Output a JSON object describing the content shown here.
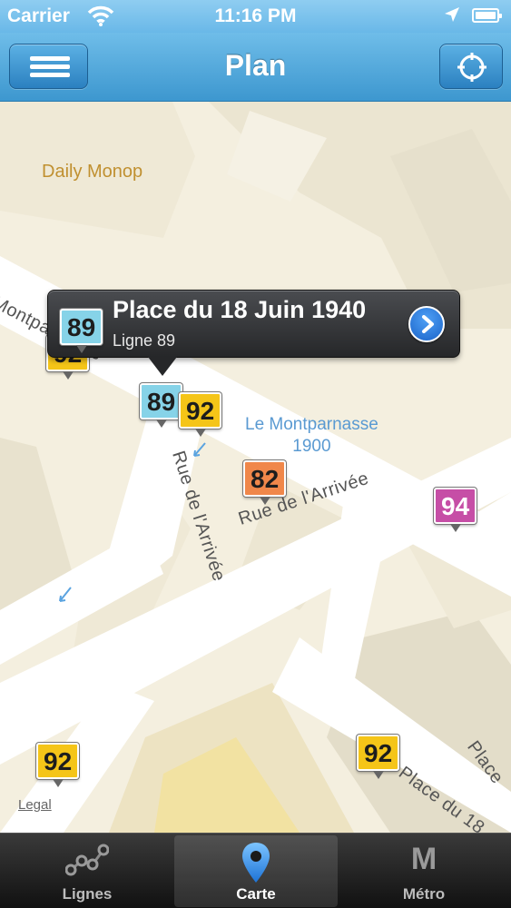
{
  "status_bar": {
    "carrier": "Carrier",
    "time": "11:16 PM"
  },
  "nav": {
    "title": "Plan",
    "menu_icon": "hamburger-menu-icon",
    "locate_icon": "crosshair-icon"
  },
  "map": {
    "poi_label": "Daily Monop",
    "landmark_line1": "Le Montparnasse",
    "landmark_line2": "1900",
    "streets": {
      "arrivee": "Rue de l'Arrivée",
      "arrivee_vertical": "Rue de l'Arrivée",
      "montparnasse": "Montparnasse",
      "place": "Place du 18",
      "place2": "Place"
    },
    "legal": "Legal",
    "stops": [
      {
        "line": "92",
        "color": "#f5c518"
      },
      {
        "line": "89",
        "color": "#86d3e8"
      },
      {
        "line": "92",
        "color": "#f5c518"
      },
      {
        "line": "82",
        "color": "#f0874a"
      },
      {
        "line": "94",
        "color": "#c64ea6"
      },
      {
        "line": "92",
        "color": "#f5c518"
      },
      {
        "line": "92",
        "color": "#f5c518"
      }
    ]
  },
  "callout": {
    "title": "Place du 18 Juin 1940",
    "subtitle": "Ligne 89",
    "badge": "89",
    "badge_color": "#86d3e8",
    "action_icon": "chevron-right-icon"
  },
  "tabs": [
    {
      "label": "Lignes",
      "icon": "lines-network-icon",
      "selected": false
    },
    {
      "label": "Carte",
      "icon": "map-pin-icon",
      "selected": true
    },
    {
      "label": "Métro",
      "icon": "metro-m-icon",
      "selected": false
    }
  ]
}
